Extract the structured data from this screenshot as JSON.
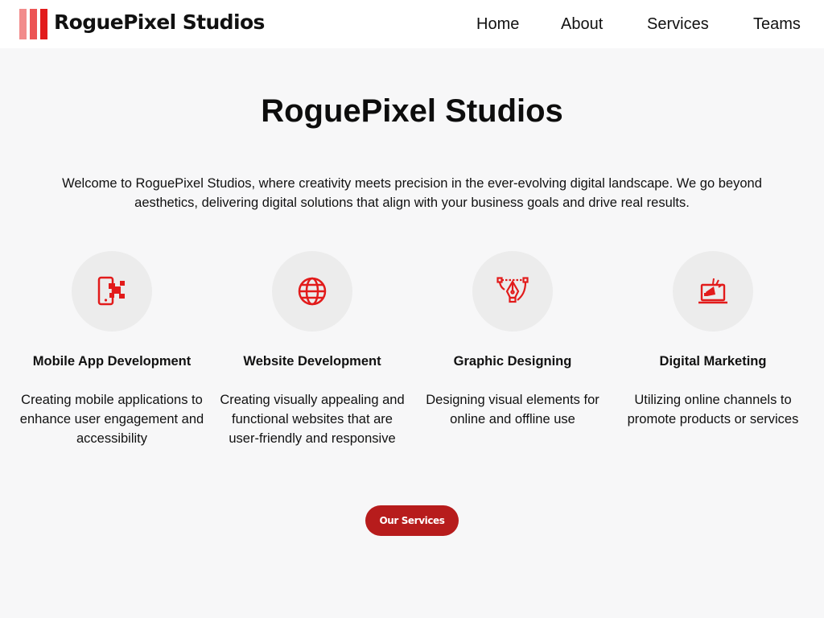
{
  "brand": {
    "name": "RoguePixel Studios",
    "colors": {
      "accent": "#e21b1b",
      "button": "#b71c1c",
      "logo_light": "#f28b8b"
    }
  },
  "nav": {
    "items": [
      {
        "label": "Home"
      },
      {
        "label": "About"
      },
      {
        "label": "Services"
      },
      {
        "label": "Teams"
      }
    ]
  },
  "hero": {
    "title": "RoguePixel Studios",
    "intro": "Welcome to RoguePixel Studios, where creativity meets precision in the ever-evolving digital landscape. We go beyond aesthetics, delivering digital solutions that align with your business goals and drive real results."
  },
  "services": [
    {
      "icon": "mobile-app-icon",
      "title": "Mobile App Development",
      "description": "Creating mobile applications to enhance user engagement and accessibility"
    },
    {
      "icon": "globe-icon",
      "title": "Website Development",
      "description": "Creating visually appealing and functional websites that are user-friendly and responsive"
    },
    {
      "icon": "pen-tool-icon",
      "title": "Graphic Designing",
      "description": "Designing visual elements for online and offline use"
    },
    {
      "icon": "megaphone-laptop-icon",
      "title": "Digital Marketing",
      "description": "Utilizing online channels to promote products or services"
    }
  ],
  "cta": {
    "label": "Our Services"
  }
}
